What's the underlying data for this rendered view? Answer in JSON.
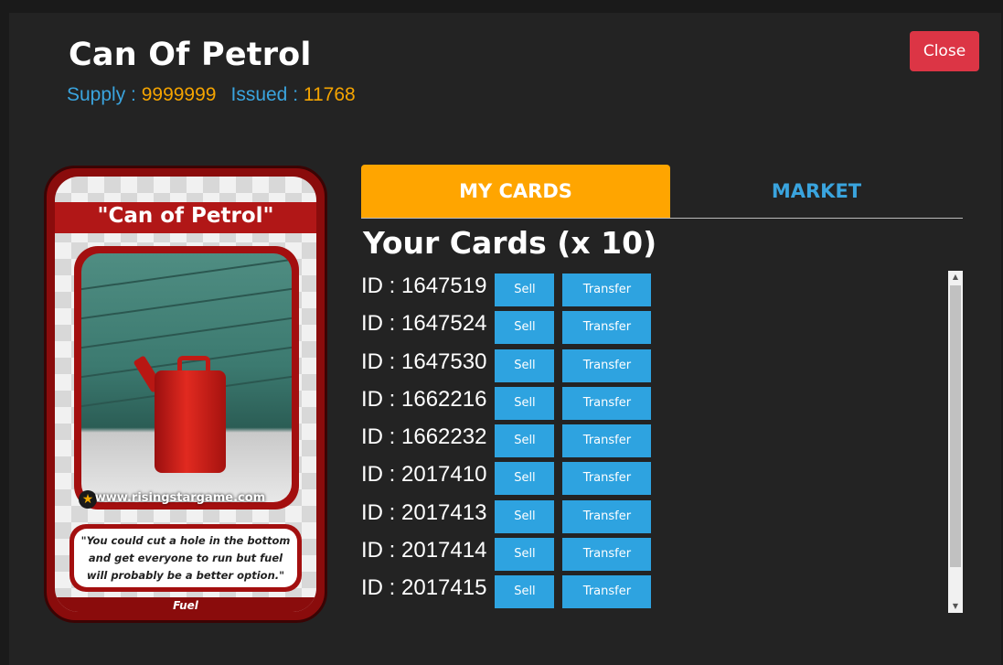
{
  "header": {
    "title": "Can Of Petrol",
    "supply_label": "Supply : ",
    "supply_value": "9999999",
    "issued_label": "Issued : ",
    "issued_value": "11768",
    "close_label": "Close"
  },
  "card_art": {
    "name": "\"Can of Petrol\"",
    "url": "www.risingstargame.com",
    "quote_lines": [
      "\"You could cut a hole in the bottom",
      "and get everyone to run but fuel",
      "will probably be a better option.\""
    ],
    "type": "Fuel"
  },
  "tabs": {
    "my_cards": "MY CARDS",
    "market": "MARKET"
  },
  "list": {
    "heading": "Your Cards (x 10)",
    "sell_label": "Sell",
    "transfer_label": "Transfer",
    "cards": [
      {
        "id": "ID : 1647519"
      },
      {
        "id": "ID : 1647524"
      },
      {
        "id": "ID : 1647530"
      },
      {
        "id": "ID : 1662216"
      },
      {
        "id": "ID : 1662232"
      },
      {
        "id": "ID : 2017410"
      },
      {
        "id": "ID : 2017413"
      },
      {
        "id": "ID : 2017414"
      },
      {
        "id": "ID : 2017415"
      }
    ]
  },
  "colors": {
    "accent_orange": "#ffa500",
    "accent_blue": "#3aa4de",
    "close_red": "#dc3545"
  }
}
